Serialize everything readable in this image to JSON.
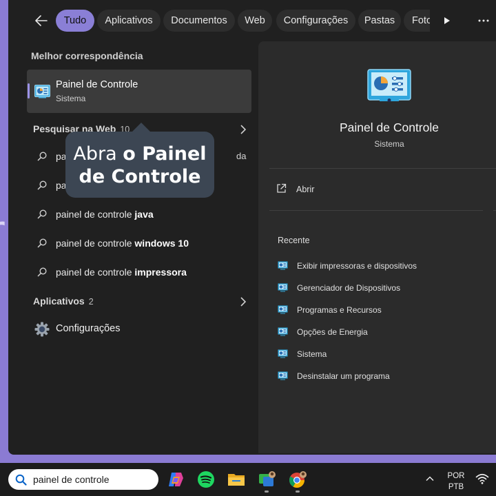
{
  "background": {
    "glyph": "r"
  },
  "filters": {
    "back_icon": "arrow-left-icon",
    "chips": [
      "Tudo",
      "Aplicativos",
      "Documentos",
      "Web",
      "Configurações",
      "Pastas",
      "Foto"
    ],
    "active": "Tudo",
    "play_icon": "play-icon",
    "more_icon": "more-icon"
  },
  "left": {
    "best_match_title": "Melhor correspondência",
    "best_match": {
      "name": "Painel de Controle",
      "sub": "Sistema",
      "icon": "control-panel-icon"
    },
    "web": {
      "title": "Pesquisar na Web",
      "count": "10",
      "results": [
        {
          "prefix": "pa",
          "bold": ""
        },
        {
          "prefix": "pa",
          "bold": ""
        },
        {
          "prefix": "painel de controle ",
          "bold": "java"
        },
        {
          "prefix": "painel de controle ",
          "bold": "windows 10"
        },
        {
          "prefix": "painel de controle ",
          "bold": "impressora"
        }
      ],
      "result1_tail": "da p..."
    },
    "apps": {
      "title": "Aplicativos",
      "count": "2",
      "items": [
        {
          "name": "Configurações",
          "icon": "gear-icon"
        }
      ]
    }
  },
  "callout": {
    "line1_normal": "Abra ",
    "line1_bold": "o Painel",
    "line2_bold": "de Controle"
  },
  "detail": {
    "title": "Painel de Controle",
    "subtitle": "Sistema",
    "open_label": "Abrir",
    "recent_title": "Recente",
    "recent": [
      "Exibir impressoras e dispositivos",
      "Gerenciador de Dispositivos",
      "Programas e Recursos",
      "Opções de Energia",
      "Sistema",
      "Desinstalar um programa"
    ]
  },
  "taskbar": {
    "search_text": "painel de controle",
    "apps": [
      "copilot-icon",
      "spotify-icon",
      "file-explorer-icon",
      "photos-editor-icon",
      "chrome-icon"
    ],
    "lang_line1": "POR",
    "lang_line2": "PTB"
  },
  "colors": {
    "desktop": "#8b7bd3",
    "panel": "#202020",
    "detail": "#2b2b2b",
    "accent": "#8a7fd6",
    "callout": "#3c4653"
  }
}
